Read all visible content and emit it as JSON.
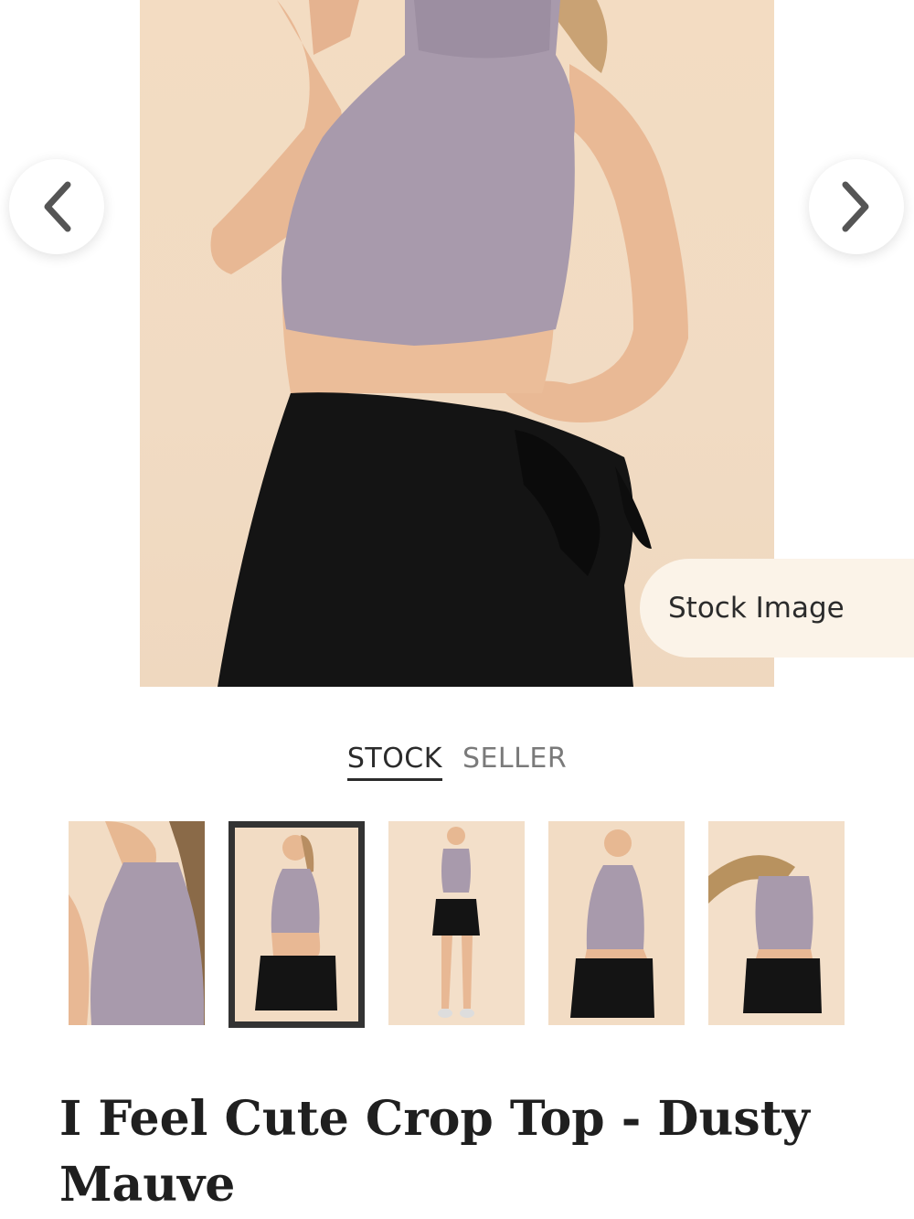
{
  "product": {
    "title": "I Feel Cute Crop Top - Dusty Mauve",
    "image_badge": "Stock Image"
  },
  "gallery": {
    "prev_icon": "chevron-left-icon",
    "next_icon": "chevron-right-icon",
    "tabs": [
      {
        "label": "STOCK",
        "active": true
      },
      {
        "label": "SELLER",
        "active": false
      }
    ],
    "thumbnails_count": 5,
    "selected_thumbnail": 2
  },
  "colors": {
    "top": "#a89aac",
    "skirt": "#121212",
    "backdrop": "#f2dcc4",
    "skin": "#e8b894"
  }
}
